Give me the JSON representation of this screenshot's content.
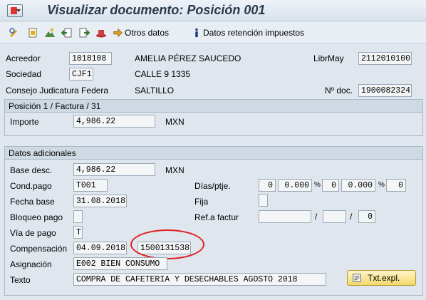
{
  "window": {
    "title": "Visualizar documento: Posición 001"
  },
  "toolbar": {
    "otros_datos": "Otros datos",
    "datos_retencion": "Datos retención impuestos"
  },
  "header": {
    "acreedor_label": "Acreedor",
    "acreedor_value": "1018108",
    "acreedor_name": "AMELIA PÉREZ SAUCEDO",
    "librmay_label": "LibrMay",
    "librmay_value": "2112010100",
    "sociedad_label": "Sociedad",
    "sociedad_value": "CJF1",
    "address": "CALLE 9 1335",
    "company_name": "Consejo Judicatura Federa",
    "city": "SALTILLO",
    "nodoc_label": "Nº doc.",
    "nodoc_value": "1900082324"
  },
  "position": {
    "title": "Posición 1 / Factura / 31",
    "importe_label": "Importe",
    "importe_value": "4,986.22",
    "currency": "MXN"
  },
  "additional": {
    "title": "Datos adicionales",
    "base_desc_label": "Base desc.",
    "base_desc_value": "4,986.22",
    "currency": "MXN",
    "cond_pago_label": "Cond.pago",
    "cond_pago_value": "T001",
    "dias_label": "Días/ptje.",
    "dias1": "0",
    "pct1": "0.000",
    "dias2": "0",
    "pct2": "0.000",
    "dias3": "0",
    "pct_sign": "%",
    "fecha_base_label": "Fecha base",
    "fecha_base_value": "31.08.2018",
    "fija_label": "Fija",
    "bloqueo_label": "Bloqueo pago",
    "ref_label": "Ref.a factur",
    "ref_slash": "/",
    "ref_value": "0",
    "via_label": "Vía de pago",
    "via_value": "T",
    "comp_label": "Compensación",
    "comp_date": "04.09.2018",
    "comp_doc": "1500131538",
    "asig_label": "Asignación",
    "asig_value": "E002 BIEN CONSUMO",
    "texto_label": "Texto",
    "texto_value": "COMPRA DE CAFETERIA Y DESECHABLES AGOSTO 2018",
    "txt_expl": "Txt.expl."
  }
}
